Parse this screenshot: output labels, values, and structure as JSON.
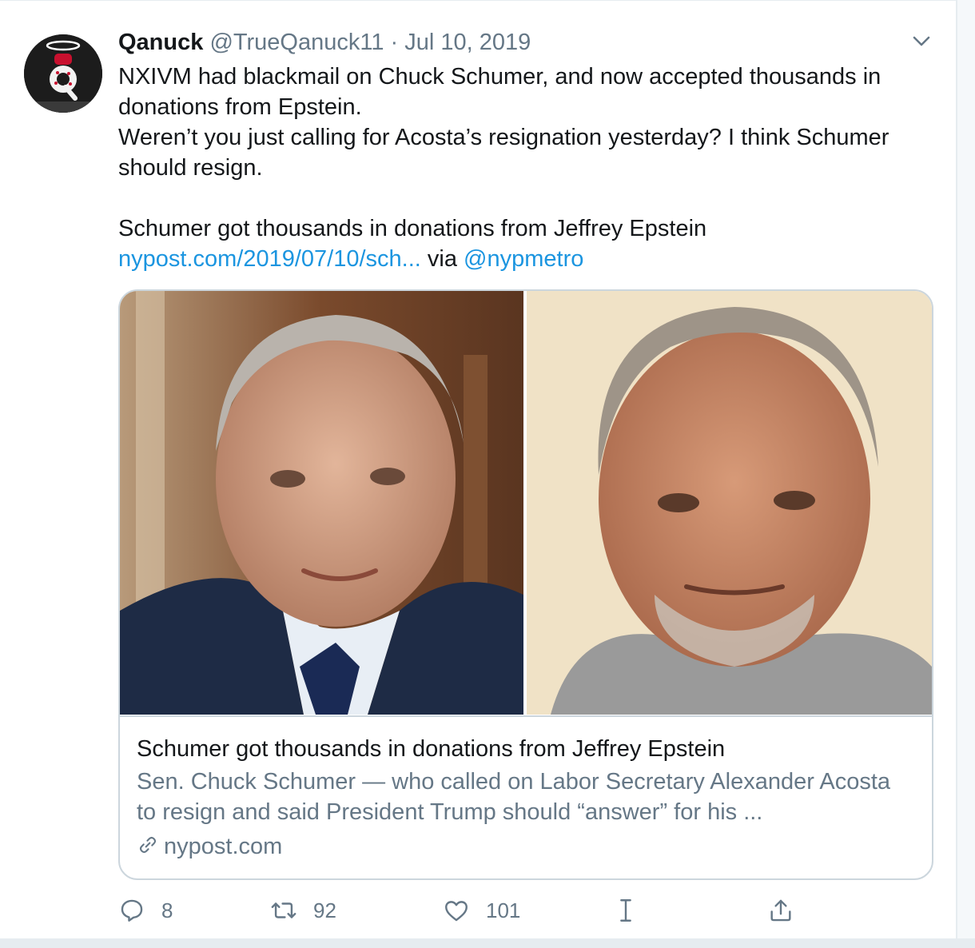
{
  "tweet": {
    "display_name": "Qanuck",
    "handle": "@TrueQanuck11",
    "separator": "·",
    "date": "Jul 10, 2019",
    "lines": [
      "NXIVM had blackmail on Chuck Schumer, and now accepted thousands in donations from Epstein.",
      "Weren’t you just calling for Acosta’s resignation yesterday? I think Schumer should resign."
    ],
    "share_text": "Schumer got thousands in donations from Jeffrey Epstein",
    "share_link": "nypost.com/2019/07/10/sch...",
    "via_text": " via ",
    "via_handle": "@nypmetro"
  },
  "card": {
    "title": "Schumer got thousands in donations from Jeffrey Epstein",
    "description": "Sen. Chuck Schumer — who called on Labor Secretary Alexander Acosta to resign and said President Trump should “answer” for his ...",
    "domain": "nypost.com"
  },
  "actions": {
    "replies": "8",
    "retweets": "92",
    "likes": "101"
  },
  "colors": {
    "link": "#1b95e0",
    "muted": "#657786",
    "text": "#14171a",
    "border": "#ccd6dd"
  },
  "icons": [
    "avatar-q-logo",
    "chevron-down-icon",
    "link-icon",
    "reply-icon",
    "retweet-icon",
    "like-icon",
    "text-cursor-icon",
    "share-icon"
  ]
}
